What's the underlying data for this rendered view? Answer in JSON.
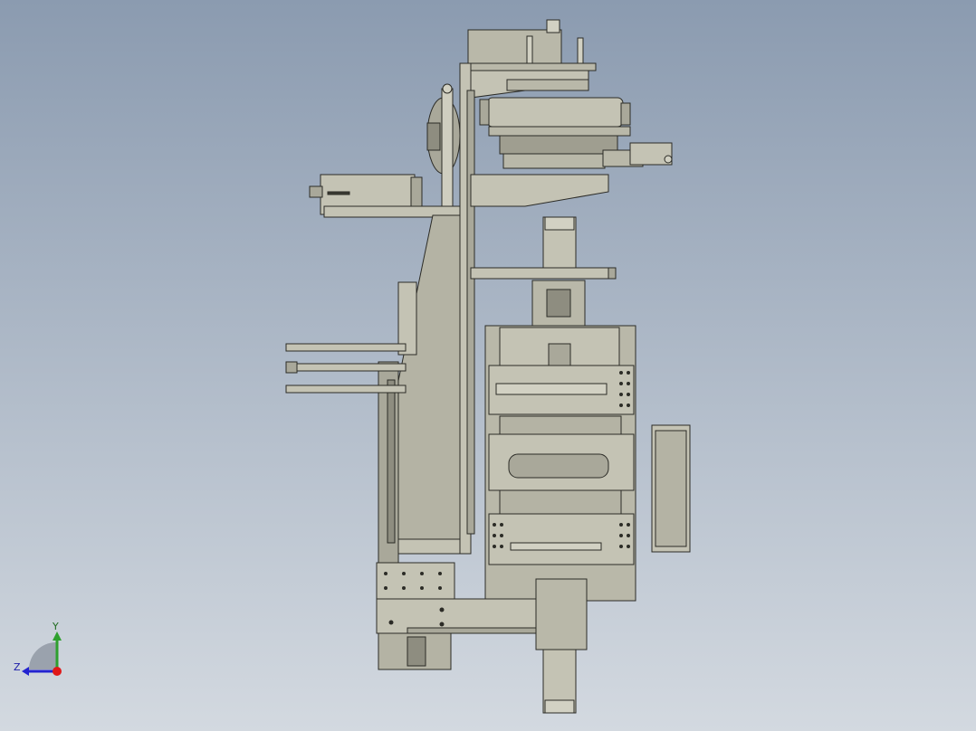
{
  "viewport": {
    "background_top": "#8b9bb0",
    "background_bottom": "#d3d9e0",
    "part_fill": "#b9b8a9",
    "part_fill_dark": "#8e8d80",
    "part_fill_light": "#d2d1c3",
    "edge_color": "#2b2b26"
  },
  "triad": {
    "y_label": "Y",
    "z_label": "Z",
    "y_color": "#2ea02e",
    "z_color": "#2323d0",
    "origin_color": "#e01818"
  }
}
